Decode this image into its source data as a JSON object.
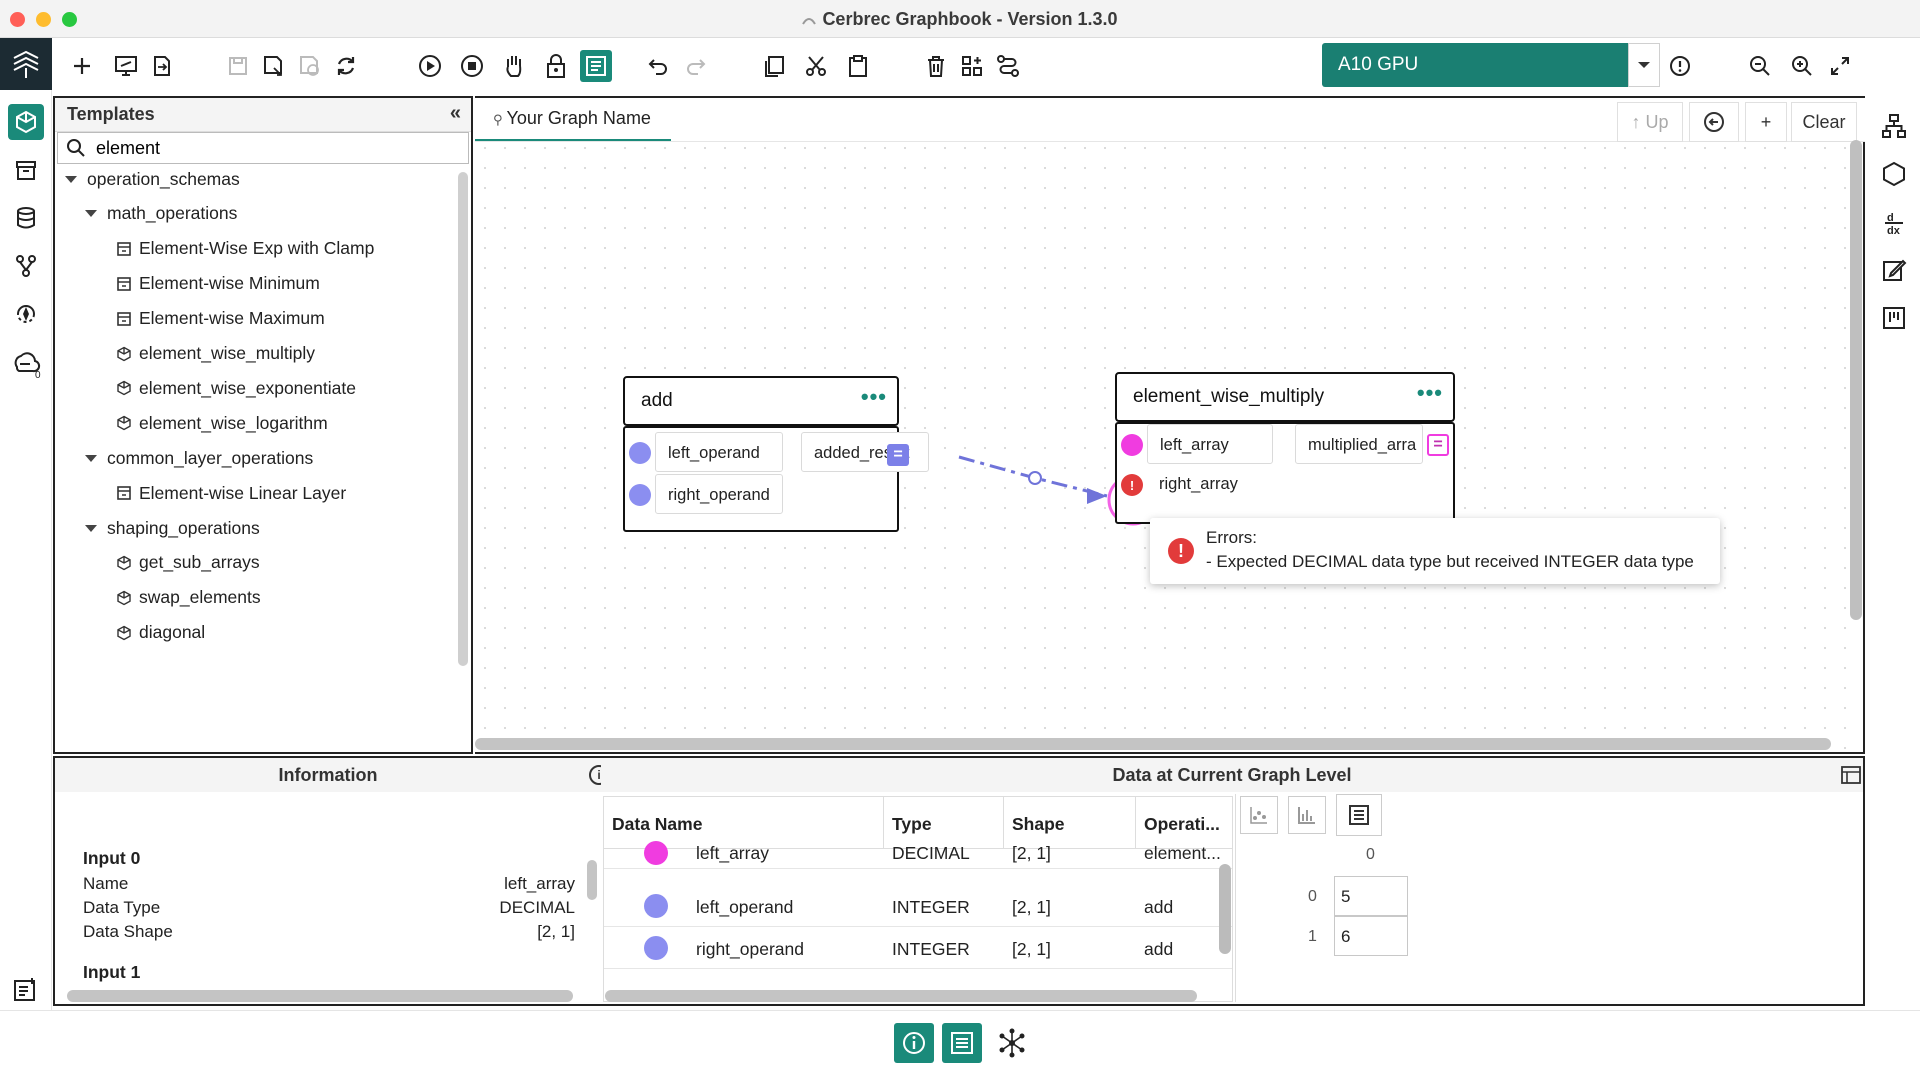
{
  "window": {
    "title": "Cerbrec Graphbook - Version 1.3.0"
  },
  "toolbar": {
    "gpu_selected": "A10 GPU"
  },
  "templates": {
    "header": "Templates",
    "search_value": "element",
    "tree": [
      {
        "label": "operation_schemas",
        "level": 0,
        "type": "folder"
      },
      {
        "label": "math_operations",
        "level": 1,
        "type": "folder"
      },
      {
        "label": "Element-Wise Exp with Clamp",
        "level": 2,
        "type": "composite"
      },
      {
        "label": "Element-wise Minimum",
        "level": 2,
        "type": "composite"
      },
      {
        "label": "Element-wise Maximum",
        "level": 2,
        "type": "composite"
      },
      {
        "label": "element_wise_multiply",
        "level": 2,
        "type": "primitive"
      },
      {
        "label": "element_wise_exponentiate",
        "level": 2,
        "type": "primitive"
      },
      {
        "label": "element_wise_logarithm",
        "level": 2,
        "type": "primitive"
      },
      {
        "label": "common_layer_operations",
        "level": 1,
        "type": "folder"
      },
      {
        "label": "Element-wise Linear Layer",
        "level": 2,
        "type": "composite"
      },
      {
        "label": "shaping_operations",
        "level": 1,
        "type": "folder"
      },
      {
        "label": "get_sub_arrays",
        "level": 2,
        "type": "primitive"
      },
      {
        "label": "swap_elements",
        "level": 2,
        "type": "primitive"
      },
      {
        "label": "diagonal",
        "level": 2,
        "type": "primitive"
      }
    ]
  },
  "graph": {
    "tab_name": "Your Graph Name",
    "up_label": "↑ Up",
    "plus_label": "+",
    "clear_label": "Clear",
    "nodes": {
      "add": {
        "title": "add",
        "more": "•••",
        "inputs": [
          "left_operand",
          "right_operand"
        ],
        "output": "added_result"
      },
      "multiply": {
        "title": "element_wise_multiply",
        "more": "•••",
        "inputs": [
          "left_array",
          "right_array"
        ],
        "output": "multiplied_arra"
      }
    },
    "error": {
      "title": "Errors:",
      "message": "- Expected DECIMAL data type but received INTEGER data type"
    }
  },
  "info_panel": {
    "header": "Information",
    "input0_heading": "Input 0",
    "rows": [
      {
        "label": "Name",
        "value": "left_array"
      },
      {
        "label": "Data Type",
        "value": "DECIMAL"
      },
      {
        "label": "Data Shape",
        "value": "[2, 1]"
      }
    ],
    "input1_heading": "Input 1"
  },
  "data_panel": {
    "header": "Data at Current Graph Level",
    "columns": [
      "Data Name",
      "Type",
      "Shape",
      "Operati..."
    ],
    "rows": [
      {
        "name": "left_array",
        "type": "DECIMAL",
        "shape": "[2, 1]",
        "op": "element...",
        "color": "#f03ce0"
      },
      {
        "name": "left_operand",
        "type": "INTEGER",
        "shape": "[2, 1]",
        "op": "add",
        "color": "#8b8ef0"
      },
      {
        "name": "right_operand",
        "type": "INTEGER",
        "shape": "[2, 1]",
        "op": "add",
        "color": "#8b8ef0"
      }
    ],
    "viewer": {
      "col_index": "0",
      "row_indices": [
        "0",
        "1"
      ],
      "values": [
        "5",
        "6"
      ]
    }
  },
  "colors": {
    "accent": "#1a8a7a",
    "decimal_port": "#f03ce0",
    "integer_port": "#8b8ef0",
    "error": "#e23b3b"
  }
}
